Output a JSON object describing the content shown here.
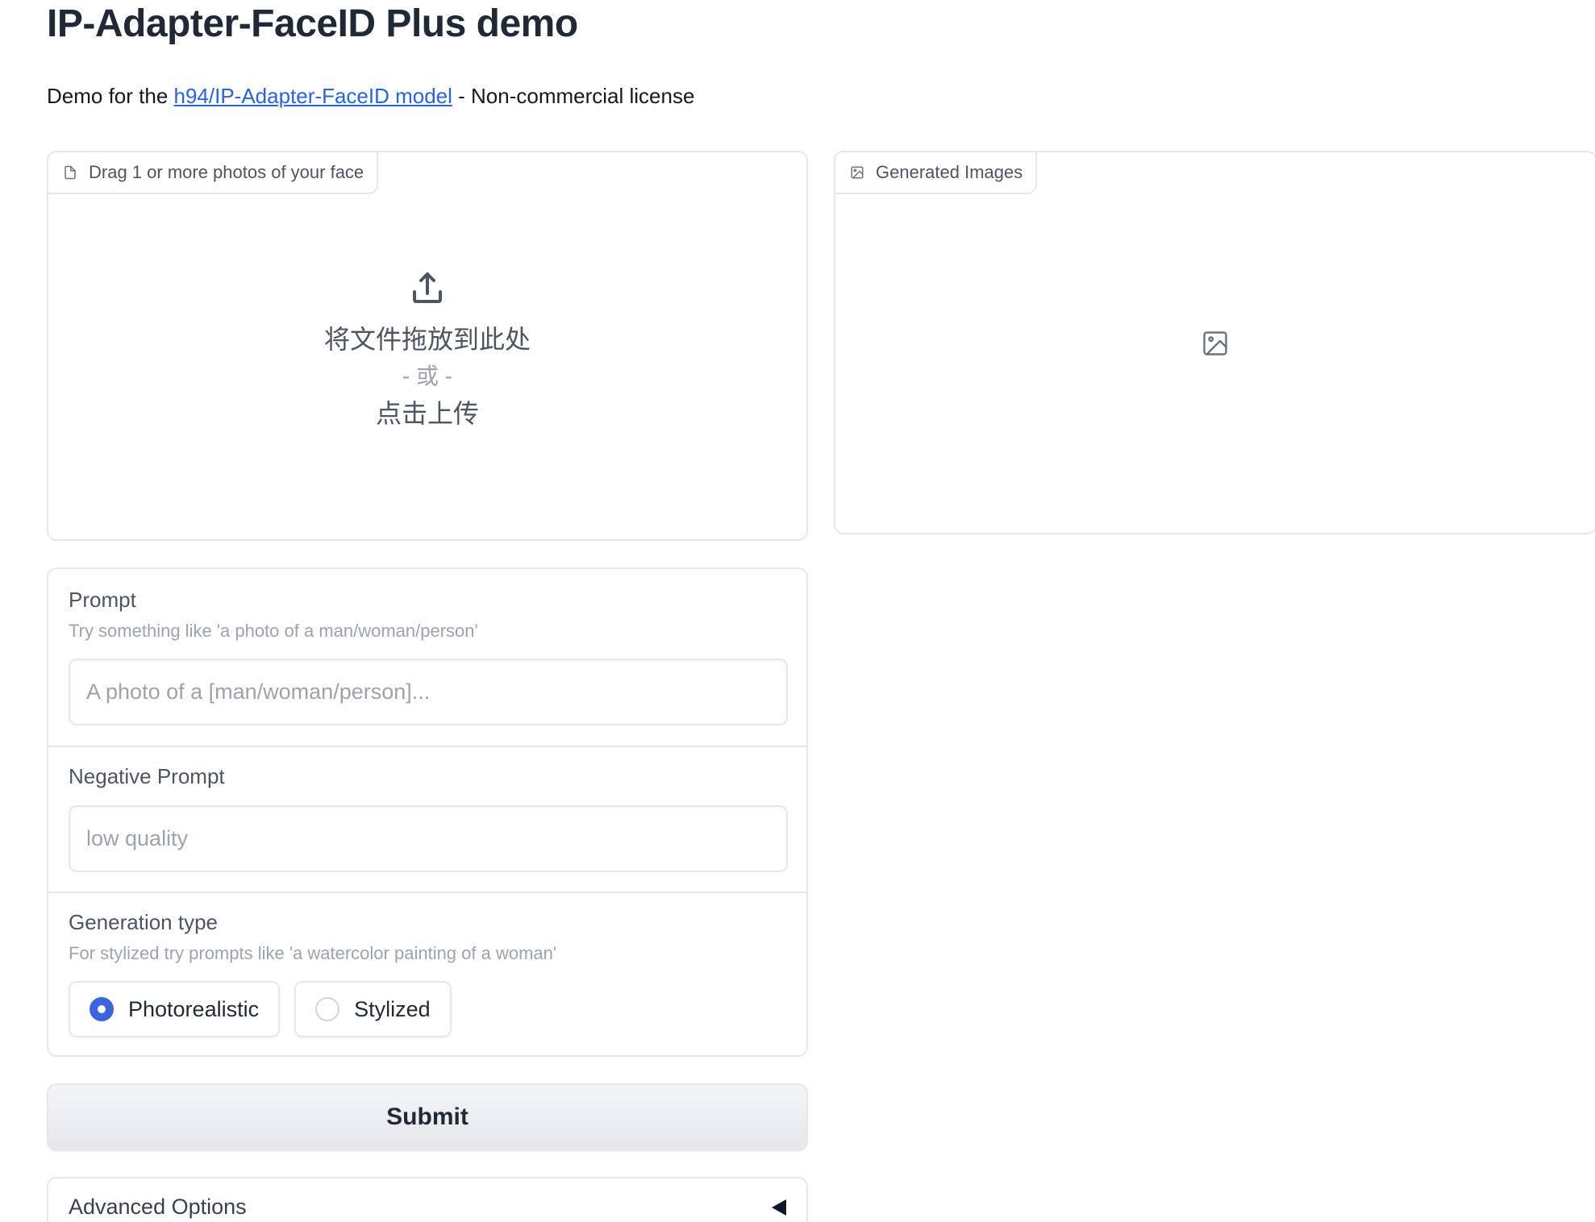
{
  "header": {
    "title": "IP-Adapter-FaceID Plus demo",
    "subtitle_prefix": "Demo for the ",
    "subtitle_link": "h94/IP-Adapter-FaceID model",
    "subtitle_suffix": " - Non-commercial license"
  },
  "upload": {
    "label": "Drag 1 or more photos of your face",
    "icon": "file-icon",
    "upload_icon": "upload-icon",
    "drop_text": "将文件拖放到此处",
    "or_text": "- 或 -",
    "click_text": "点击上传"
  },
  "gallery": {
    "label": "Generated Images",
    "icon": "image-icon",
    "empty_icon": "image-icon"
  },
  "prompt": {
    "label": "Prompt",
    "info": "Try something like 'a photo of a man/woman/person'",
    "placeholder": "A photo of a [man/woman/person]...",
    "value": ""
  },
  "negative_prompt": {
    "label": "Negative Prompt",
    "placeholder": "low quality",
    "value": ""
  },
  "generation_type": {
    "label": "Generation type",
    "info": "For stylized try prompts like 'a watercolor painting of a woman'",
    "options": [
      "Photorealistic",
      "Stylized"
    ],
    "selected": "Photorealistic"
  },
  "submit": {
    "label": "Submit"
  },
  "advanced": {
    "label": "Advanced Options",
    "collapsed": true,
    "icon": "caret-left-icon"
  },
  "colors": {
    "accent": "#3b64e0",
    "link": "#2563eb",
    "border": "#e5e7eb"
  }
}
